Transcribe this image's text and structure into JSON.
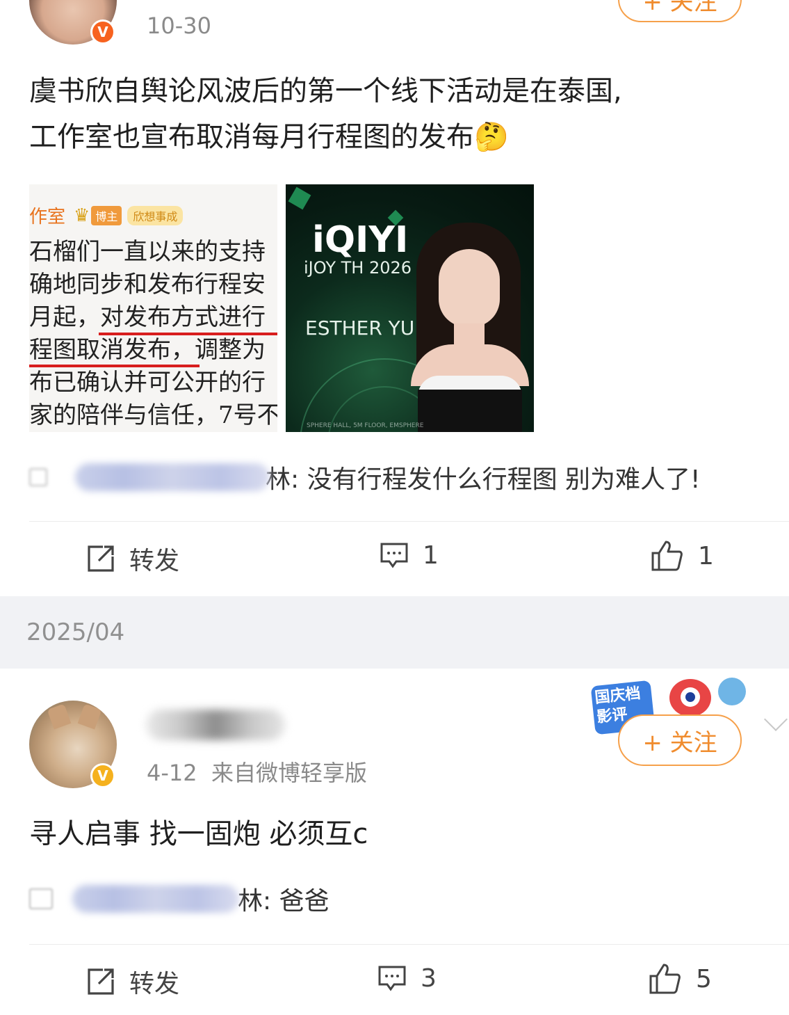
{
  "post1": {
    "date": "10-30",
    "follow_label": "+ 关注",
    "text_line1": "虞书欣自舆论风波后的第一个线下活动是在泰国,",
    "text_line2": "工作室也宣布取消每月行程图的发布",
    "emoji": "🤔",
    "image1": {
      "header": "作室",
      "badge1": "博主",
      "badge2": "欣想事成",
      "lines": [
        "石榴们一直以来的支持",
        "确地同步和发布行程安",
        "月起，对发布方式进行",
        "程图取消发布，调整为",
        "布已确认并可公开的行",
        "家的陪伴与信任，7号不"
      ]
    },
    "image2": {
      "brand": "iQIYI",
      "subtitle": "iJOY TH 2026",
      "name": "ESTHER YU",
      "footer": "SPHERE HALL, 5M FLOOR, EMSPHERE"
    },
    "comment_suffix": "林: 没有行程发什么行程图 别为难人了!",
    "actions": {
      "repost": "转发",
      "comments": "1",
      "likes": "1"
    }
  },
  "date_band": "2025/04",
  "post2": {
    "date_source": "4-12  来自微博轻享版",
    "follow_label": "+ 关注",
    "banner_text": "国庆档 影评",
    "text": "寻人启事 找一固炮 必须互c",
    "comment_suffix": "林: 爸爸",
    "actions": {
      "repost": "转发",
      "comments": "3",
      "likes": "5"
    }
  },
  "colors": {
    "accent_orange": "#f08c2e",
    "vbadge_red": "#f7621f",
    "vbadge_gold": "#f5b11e",
    "underline_red": "#d81e1e"
  }
}
